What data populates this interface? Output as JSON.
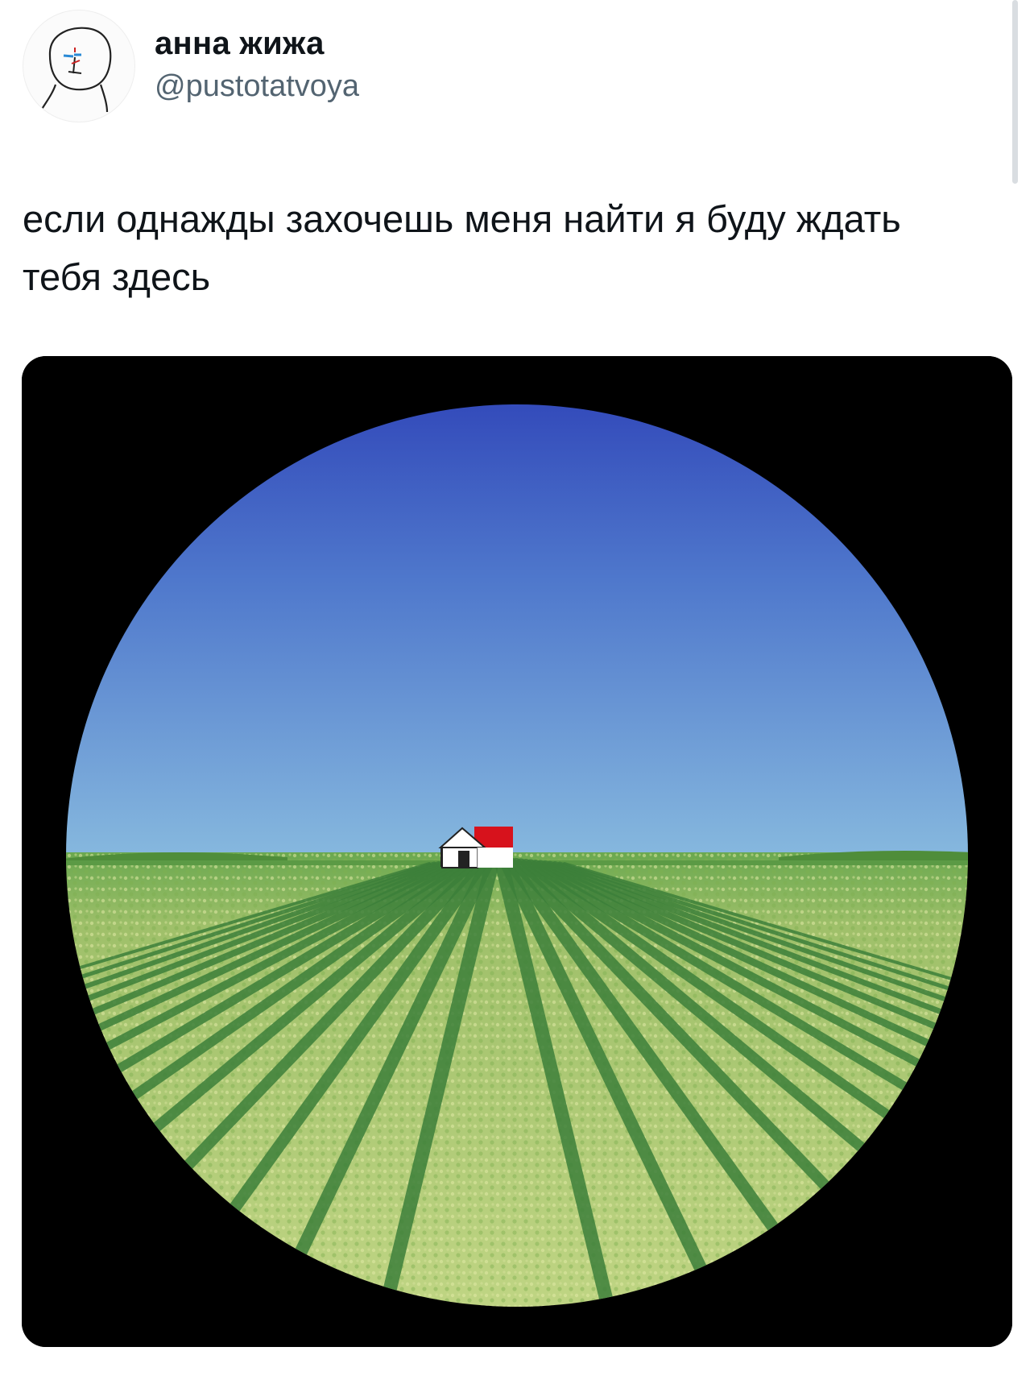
{
  "author": {
    "display_name": "анна жижа",
    "handle": "@pustotatvoya",
    "avatar_icon": "hand-drawn-face-avatar"
  },
  "tweet": {
    "text": "если однажды захочешь меня найти я буду ждать тебя здесь"
  },
  "media": {
    "icon": "field-house-circle-image",
    "colors": {
      "frame": "#000000",
      "sky_top": "#2c41b8",
      "sky_bottom": "#7eb3de",
      "field_light": "#b9cf7c",
      "field_dark": "#3f8a3c",
      "roof": "#d7121c",
      "house_wall": "#ffffff"
    }
  }
}
